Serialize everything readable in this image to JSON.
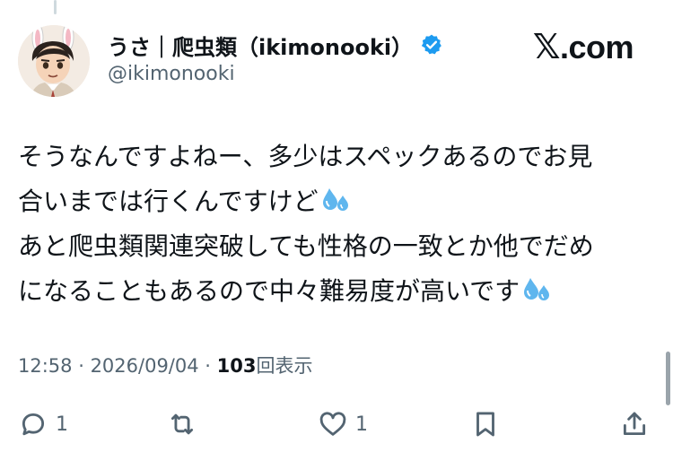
{
  "author": {
    "display_name": "うさ｜爬虫類（ikimonooki）",
    "handle": "@ikimonooki",
    "avatar_icon": "anime-avatar-bunny-ears",
    "verified_icon": "verified-badge-icon"
  },
  "brand": {
    "x_mark": "𝕏",
    "suffix": ".com"
  },
  "post": {
    "lines": [
      "そうなんですよねー、多少はスペックあるのでお見",
      "合いまでは行くんですけど",
      "あと爬虫類関連突破しても性格の一致とか他でだめ",
      "になることもあるので中々難易度が高いです"
    ],
    "emoji": "sweat-droplets"
  },
  "meta": {
    "time": "12:58",
    "separator": " · ",
    "date": "2026/09/04",
    "views_count": "103",
    "views_label": "回表示"
  },
  "actions": {
    "reply_count": "1",
    "retweet_count": "",
    "like_count": "1"
  },
  "colors": {
    "text": "#0f1419",
    "secondary": "#536471",
    "verified": "#1d9bf0"
  }
}
